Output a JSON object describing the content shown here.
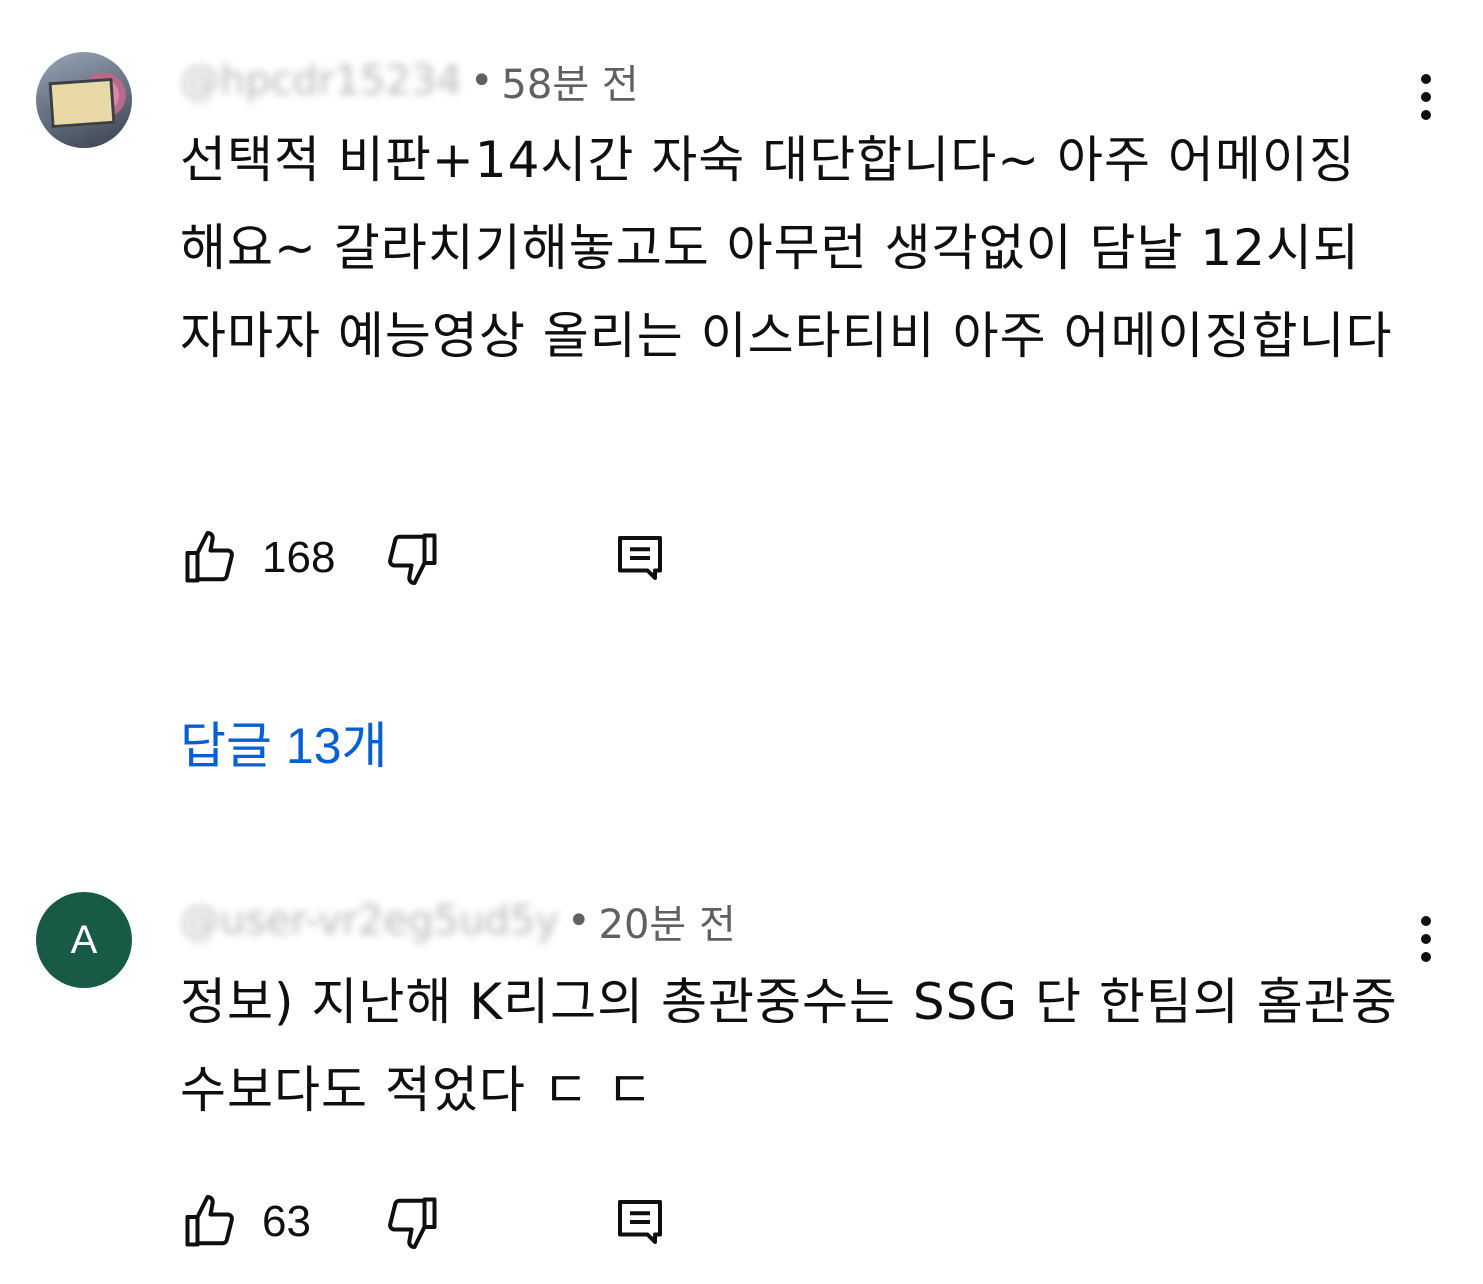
{
  "comments": [
    {
      "handle": "@hpcdr15234",
      "time": "58분 전",
      "text": "선택적 비판+14시간 자숙 대단합니다~ 아주 어메이징해요~ 갈라치기해놓고도 아무런 생각없이 담날 12시되자마자 예능영상 올리는 이스타티비 아주 어메이징합니다",
      "likes": "168",
      "replies_label": "답글 13개",
      "avatar_icon": "photo-avatar"
    },
    {
      "handle": "@user-vr2eg5ud5y",
      "time": "20분 전",
      "text": "정보) 지난해 K리그의 총관중수는 SSG 단 한팀의 홈관중수보다도 적었다 ㄷ ㄷ",
      "likes": "63",
      "avatar_letter": "A",
      "avatar_color": "#175b46"
    }
  ],
  "icons": {
    "like": "thumbs-up-icon",
    "dislike": "thumbs-down-icon",
    "reply": "comment-reply-icon",
    "more": "more-vertical-icon"
  },
  "colors": {
    "link": "#065fd4",
    "meta": "#606060"
  }
}
